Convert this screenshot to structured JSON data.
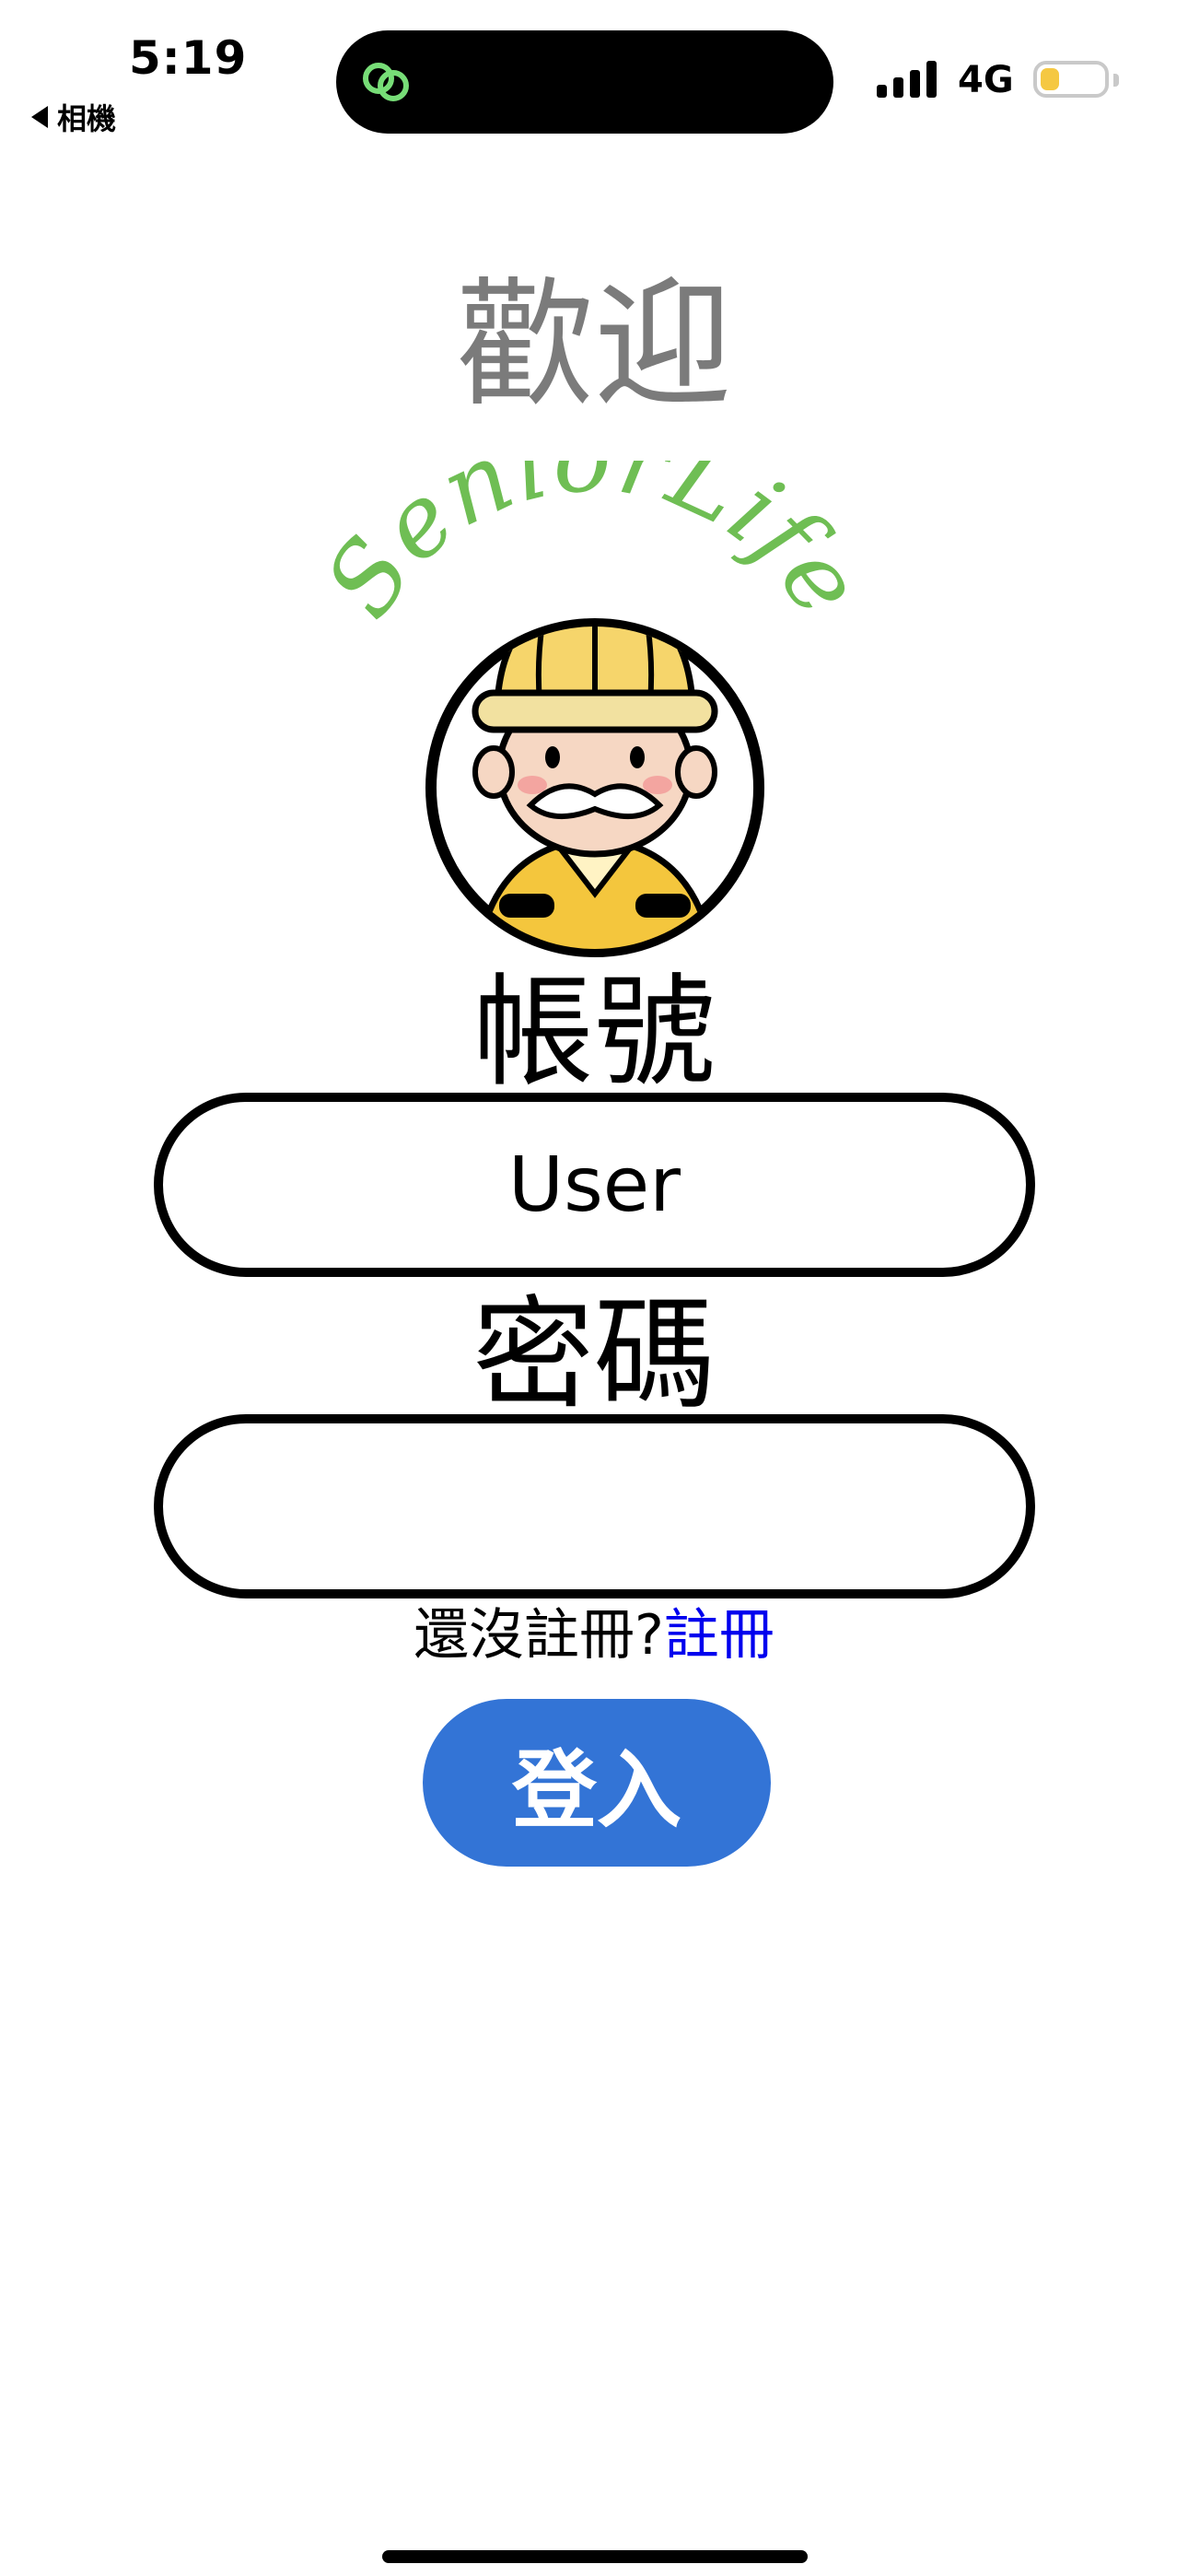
{
  "status_bar": {
    "time": "5:19",
    "back_label": "相機",
    "network": "4G",
    "battery_level": 0.3,
    "battery_color": "#f5c842",
    "island_icon": "link-chain-icon",
    "island_icon_color": "#77dd77"
  },
  "welcome": {
    "title": "歡迎"
  },
  "logo": {
    "brand": "SeniorLife",
    "brand_color": "#6fbe54"
  },
  "form": {
    "account_label": "帳號",
    "account_value": "User",
    "password_label": "密碼",
    "password_value": "",
    "register_prompt": "還沒註冊?",
    "register_link": "註冊",
    "login_button": "登入",
    "login_color": "#3374d6"
  }
}
